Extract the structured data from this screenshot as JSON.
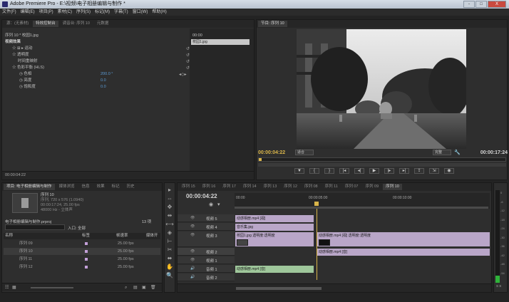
{
  "app": {
    "title": "Adobe Premiere Pro - E:\\视频\\电子相册编辑与制作 *",
    "window_buttons": [
      "-",
      "□",
      "X"
    ]
  },
  "menu": [
    "文件(F)",
    "编辑(E)",
    "项目(P)",
    "素材(C)",
    "序列(S)",
    "标记(M)",
    "字幕(T)",
    "窗口(W)",
    "帮助(H)"
  ],
  "source_panel": {
    "tabs": [
      "源：(无素材)",
      "特效控制台",
      "调音台: 序列 10",
      "元数据"
    ],
    "active_tab": 1,
    "clip_path": "序列 10 * 校园1.jpg",
    "mini_time": "00:00",
    "mini_clip_label": "校园1.jpg",
    "section_label": "视频效果",
    "rows": [
      {
        "label": "☆ ⊞ ▸ 运动"
      },
      {
        "label": "☆ 透明度"
      },
      {
        "label": "时间重映射"
      },
      {
        "label": "☆ 色彩平衡 (HLS)"
      },
      {
        "label": "◷ 色相",
        "value": "200.0 °"
      },
      {
        "label": "◷ 亮度",
        "value": "0.0"
      },
      {
        "label": "◷ 饱和度",
        "value": "0.0"
      }
    ],
    "footer_time": "00:00:04:22"
  },
  "program_monitor": {
    "tab": "节目: 序列 10",
    "timecode": "00:00:04:22",
    "fit": "适合",
    "quality": "完整",
    "duration": "00:00:17:24"
  },
  "project_panel": {
    "tabs": [
      "项目: 电子相册编辑与制作",
      "媒体浏览",
      "信息",
      "效果",
      "标记",
      "历史"
    ],
    "active_tab": 0,
    "seq_name": "序列 10",
    "seq_info": [
      "序列, 720 x 576 (1.0940)",
      "00:00:17:24, 25.00 fps",
      "48000 Hz - 立体声"
    ],
    "project_file": "电子相册编辑与制作.prproj",
    "item_count": "13 项",
    "search_placeholder": "",
    "in_label": "入口: 全部",
    "columns": [
      "名称",
      "标签",
      "帧速率",
      "媒体开"
    ],
    "items": [
      {
        "name": "序列 09",
        "fps": "25.00 fps"
      },
      {
        "name": "序列 10",
        "fps": "25.00 fps"
      },
      {
        "name": "序列 11",
        "fps": "25.00 fps"
      },
      {
        "name": "序列 12",
        "fps": "25.00 fps"
      }
    ]
  },
  "tools": [
    "▸",
    "⇔",
    "✥",
    "⇹",
    "⟷",
    "◈",
    "⊢",
    "✂",
    "⬌",
    "✋",
    "🔍"
  ],
  "timeline": {
    "tabs": [
      "序列 15",
      "序列 16",
      "序列 17",
      "序列 14",
      "序列 13",
      "序列 12",
      "序列 08",
      "序列 11",
      "序列 07",
      "序列 09",
      "序列 10"
    ],
    "timecode": "00:00:04:22",
    "ruler": [
      "00:00",
      "00:00:05:00",
      "00:00:10:00"
    ],
    "tracks": [
      {
        "name": "视频 5",
        "kind": "video"
      },
      {
        "name": "视频 4",
        "kind": "video"
      },
      {
        "name": "视频 3",
        "kind": "video"
      },
      {
        "name": "视频 2",
        "kind": "video"
      },
      {
        "name": "视频 1",
        "kind": "video"
      },
      {
        "name": "音频 1",
        "kind": "audio"
      },
      {
        "name": "音频 2",
        "kind": "audio"
      },
      {
        "name": "音频 3",
        "kind": "audio"
      },
      {
        "name": "主音轨",
        "kind": "audio"
      }
    ],
    "clips": {
      "v5": "动感相册.mp4 [视]",
      "v4": "音乐集.jpg",
      "v3a": "校园1.jpg 透明度:透明度",
      "v3b": "动感相册.mp4 [视] 透明度:透明度",
      "v1": "动感相册.mp4 [音]",
      "a3": "动感相册.mp4 [音]"
    },
    "selected_track": "视频 2"
  },
  "meter_labels": [
    "0",
    "-6",
    "-12",
    "-18",
    "-24",
    "-30",
    "-36",
    "-42",
    "-48",
    "-54"
  ],
  "meter_footer": "S S"
}
